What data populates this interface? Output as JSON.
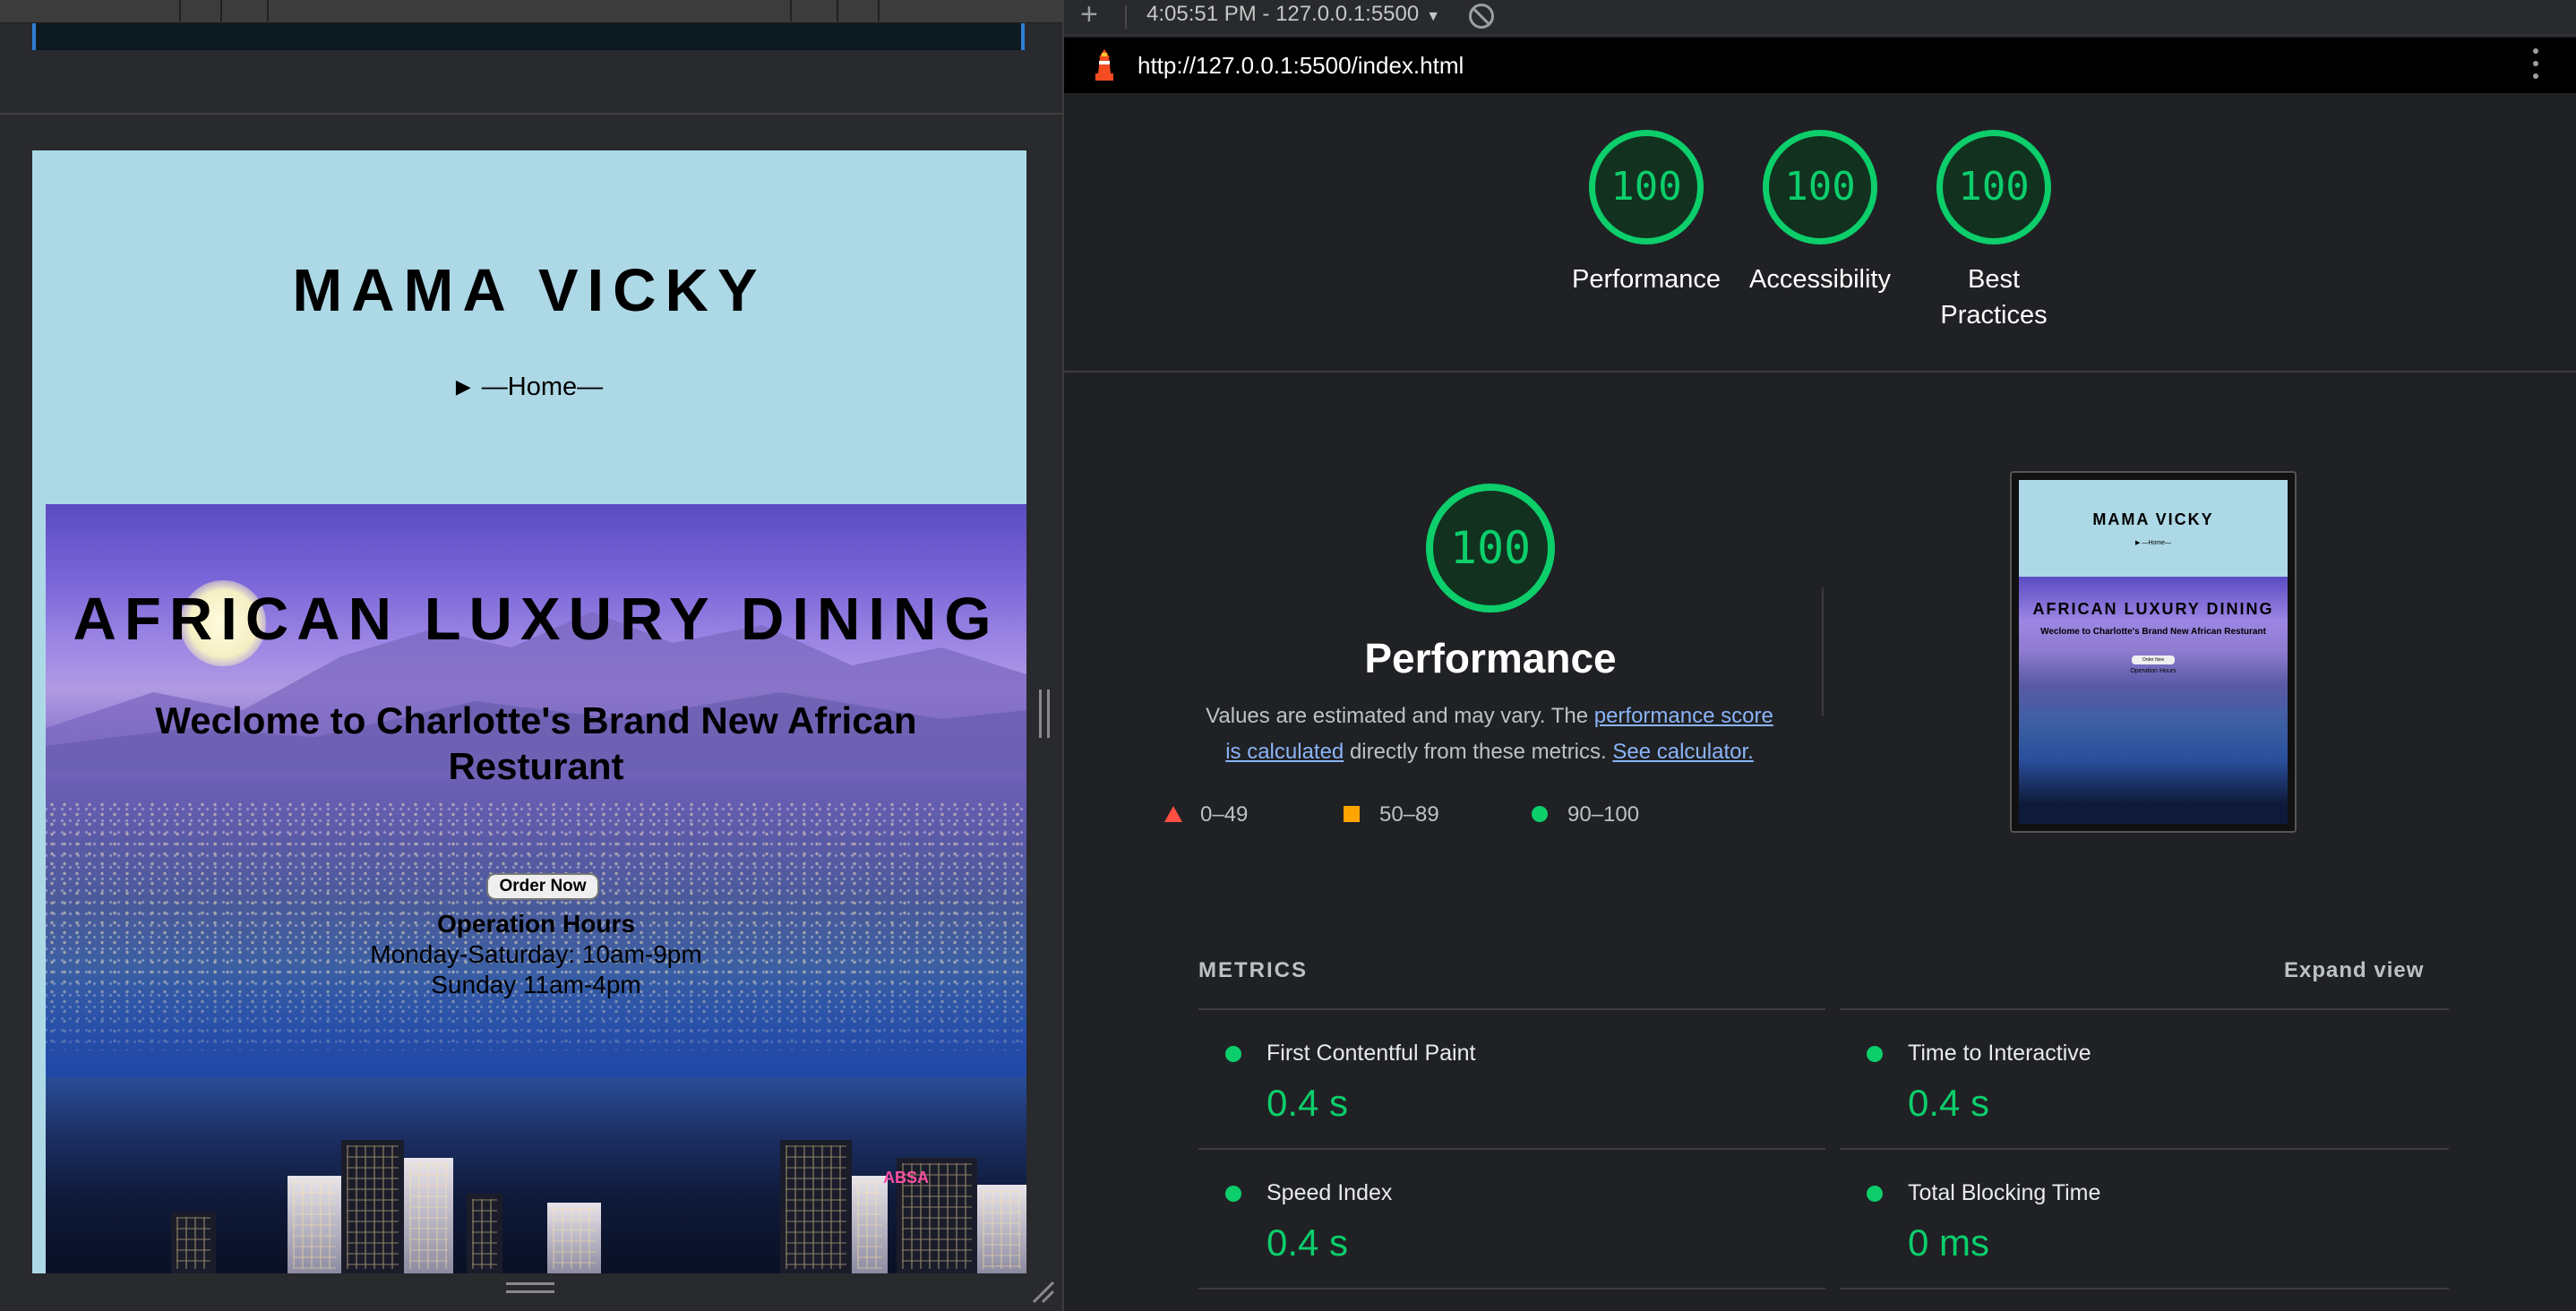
{
  "preview": {
    "site_title": "MAMA VICKY",
    "nav_label": "—Home—",
    "hero_title": "AFRICAN LUXURY DINING",
    "hero_subtitle": "Weclome to Charlotte's Brand New African Resturant",
    "order_button": "Order Now",
    "hours_title": "Operation Hours",
    "hours_lines": [
      "Monday-Saturday: 10am-9pm",
      "Sunday 11am-4pm"
    ],
    "sign_text": "ABSA"
  },
  "report_bar": {
    "add_label": "+",
    "report_select": "4:05:51 PM - 127.0.0.1:5500",
    "caret": "▼"
  },
  "url_bar": {
    "url": "http://127.0.0.1:5500/index.html"
  },
  "summary_gauges": [
    {
      "score": "100",
      "label": "Performance"
    },
    {
      "score": "100",
      "label": "Accessibility"
    },
    {
      "score": "100",
      "label": "Best Practices"
    }
  ],
  "performance": {
    "score": "100",
    "title": "Performance",
    "desc_prefix": "Values are estimated and may vary. The ",
    "desc_link1": "performance score is calculated",
    "desc_middle": " directly from these metrics. ",
    "desc_link2": "See calculator.",
    "legend": [
      {
        "range": "0–49",
        "color": "#ff4e42"
      },
      {
        "range": "50–89",
        "color": "#ffa400"
      },
      {
        "range": "90–100",
        "color": "#0cce6b"
      }
    ]
  },
  "thumbnail": {
    "title": "MAMA VICKY",
    "nav": "▶ —Home—",
    "hero_title": "AFRICAN LUXURY DINING",
    "hero_subtitle": "Weclome to Charlotte's Brand New African Resturant",
    "button": "Order Now",
    "hours": "Operation Hours"
  },
  "metrics": {
    "header": "METRICS",
    "expand_label": "Expand view",
    "items": [
      {
        "label": "First Contentful Paint",
        "value": "0.4 s"
      },
      {
        "label": "Time to Interactive",
        "value": "0.4 s"
      },
      {
        "label": "Speed Index",
        "value": "0.4 s"
      },
      {
        "label": "Total Blocking Time",
        "value": "0 ms"
      }
    ]
  },
  "colors": {
    "pass": "#0cce6b",
    "average": "#ffa400",
    "fail": "#ff4e42",
    "link": "#8ab4f8",
    "preview_bg": "#add8e6"
  }
}
